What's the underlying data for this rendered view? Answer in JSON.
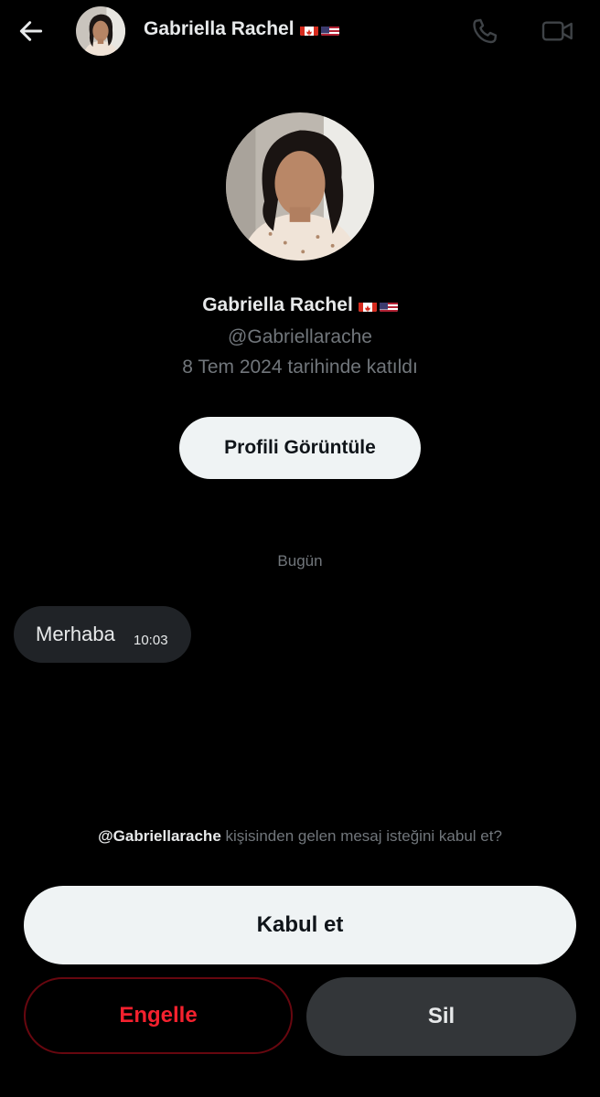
{
  "header": {
    "name": "Gabriella Rachel",
    "flags": [
      "canada-flag",
      "usa-flag"
    ],
    "back_icon": "arrow-left-icon",
    "call_icon": "phone-icon",
    "video_icon": "video-camera-icon"
  },
  "profile": {
    "name": "Gabriella Rachel",
    "handle": "@Gabriellarache",
    "joined": "8 Tem 2024 tarihinde katıldı",
    "view_profile_label": "Profili Görüntüle"
  },
  "conversation": {
    "date_separator": "Bugün",
    "messages": [
      {
        "text": "Merhaba",
        "time": "10:03"
      }
    ]
  },
  "request": {
    "handle": "@Gabriellarache",
    "text": " kişisinden gelen mesaj isteğini kabul et?",
    "accept_label": "Kabul et",
    "block_label": "Engelle",
    "delete_label": "Sil"
  },
  "colors": {
    "background": "#000000",
    "primary_text": "#e7e9ea",
    "secondary_text": "#71767b",
    "button_light": "#eff3f4",
    "button_dark": "#333639",
    "danger": "#f4212e",
    "bubble": "#202327"
  }
}
